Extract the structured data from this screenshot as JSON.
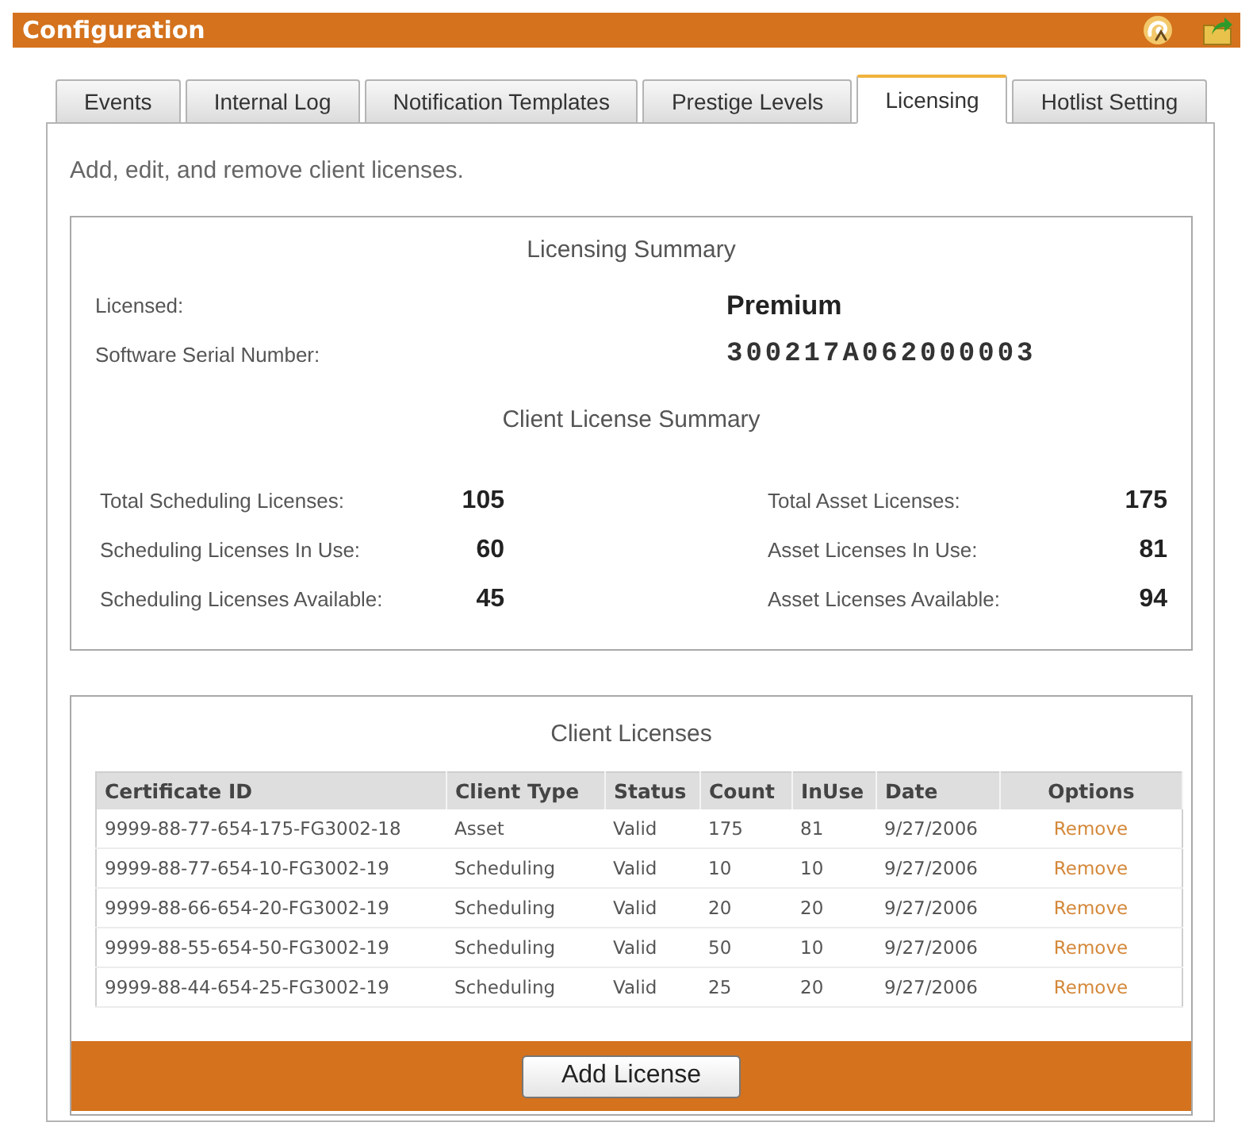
{
  "window": {
    "title": "Configuration"
  },
  "tabs": [
    {
      "label": "Events",
      "selected": false
    },
    {
      "label": "Internal Log",
      "selected": false
    },
    {
      "label": "Notification Templates",
      "selected": false
    },
    {
      "label": "Prestige Levels",
      "selected": false
    },
    {
      "label": "Licensing",
      "selected": true
    },
    {
      "label": "Hotlist Setting",
      "selected": false
    }
  ],
  "description": "Add, edit, and remove client licenses.",
  "licensing_summary": {
    "title": "Licensing Summary",
    "fields": [
      {
        "label": "Licensed:",
        "value": "Premium",
        "kind": "text"
      },
      {
        "label": "Software Serial Number:",
        "value": "300217A062000003",
        "kind": "code"
      }
    ]
  },
  "client_license_summary": {
    "title": "Client License Summary",
    "groups": [
      {
        "items": [
          {
            "label": "Total Scheduling Licenses:",
            "value": "105"
          },
          {
            "label": "Scheduling Licenses In Use:",
            "value": "60"
          },
          {
            "label": "Scheduling Licenses Available:",
            "value": "45"
          }
        ]
      },
      {
        "items": [
          {
            "label": "Total Asset Licenses:",
            "value": "175"
          },
          {
            "label": "Asset Licenses In Use:",
            "value": "81"
          },
          {
            "label": "Asset Licenses Available:",
            "value": "94"
          }
        ]
      }
    ]
  },
  "client_licenses": {
    "title": "Client Licenses",
    "columns": [
      "Certificate ID",
      "Client Type",
      "Status",
      "Count",
      "InUse",
      "Date",
      "Options"
    ],
    "rows": [
      {
        "cells": [
          "9999-88-77-654-175-FG3002-18",
          "Asset",
          "Valid",
          "175",
          "81",
          "9/27/2006"
        ],
        "action": "Remove"
      },
      {
        "cells": [
          "9999-88-77-654-10-FG3002-19",
          "Scheduling",
          "Valid",
          "10",
          "10",
          "9/27/2006"
        ],
        "action": "Remove"
      },
      {
        "cells": [
          "9999-88-66-654-20-FG3002-19",
          "Scheduling",
          "Valid",
          "20",
          "20",
          "9/27/2006"
        ],
        "action": "Remove"
      },
      {
        "cells": [
          "9999-88-55-654-50-FG3002-19",
          "Scheduling",
          "Valid",
          "50",
          "10",
          "9/27/2006"
        ],
        "action": "Remove"
      },
      {
        "cells": [
          "9999-88-44-654-25-FG3002-19",
          "Scheduling",
          "Valid",
          "25",
          "20",
          "9/27/2006"
        ],
        "action": "Remove"
      }
    ]
  },
  "add_button": {
    "label": "Add License"
  }
}
